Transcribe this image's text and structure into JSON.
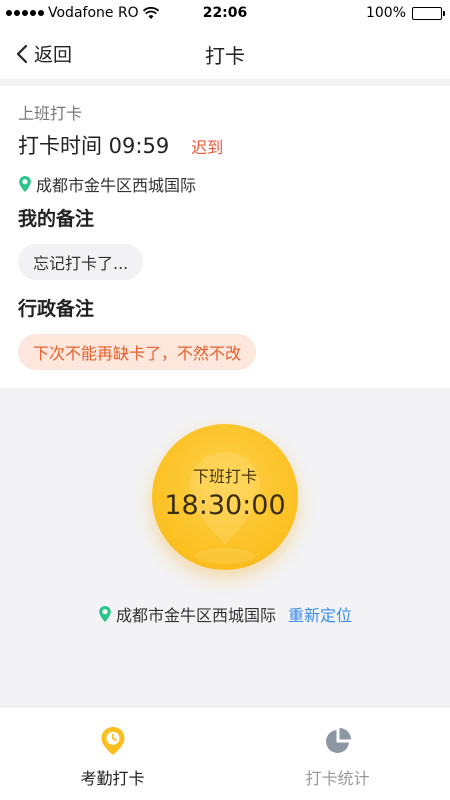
{
  "status_bar": {
    "carrier": "Vodafone RO",
    "time": "22:06",
    "battery": "100%"
  },
  "nav": {
    "back_label": "返回",
    "title": "打卡"
  },
  "checkin": {
    "section_label": "上班打卡",
    "time_text": "打卡时间 09:59",
    "late_tag": "迟到",
    "location": "成都市金牛区西城国际",
    "my_note_title": "我的备注",
    "my_note": "忘记打卡了...",
    "admin_note_title": "行政备注",
    "admin_note": "下次不能再缺卡了，不然不改"
  },
  "punch": {
    "label": "下班打卡",
    "time": "18:30:00",
    "location": "成都市金牛区西城国际",
    "relocate": "重新定位"
  },
  "tabs": [
    {
      "label": "考勤打卡",
      "icon": "clock-pin-icon",
      "active": true
    },
    {
      "label": "打卡统计",
      "icon": "pie-chart-icon",
      "active": false
    }
  ],
  "colors": {
    "accent": "#fbbf20",
    "late": "#f05a3a",
    "admin_note_text": "#e8602c",
    "admin_note_bg": "#fde6dc",
    "link": "#3a8ee6",
    "location_pin": "#2bc48a"
  }
}
